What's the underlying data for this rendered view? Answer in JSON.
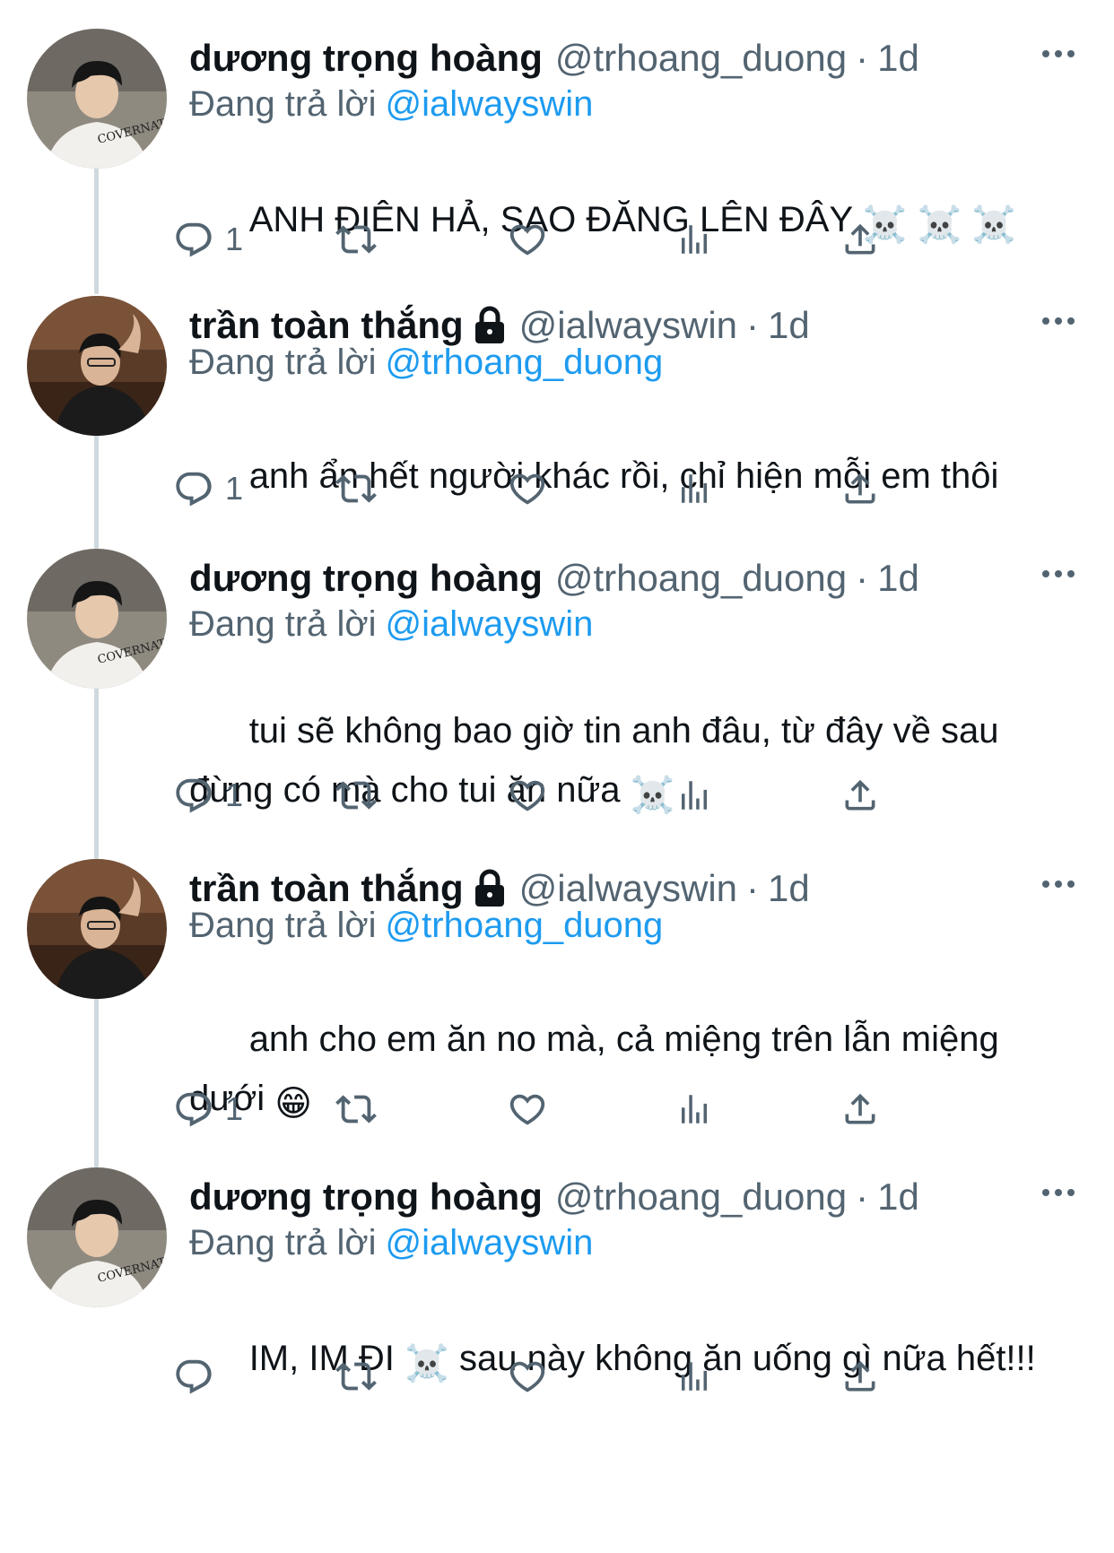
{
  "thread": {
    "tweets": [
      {
        "name": "dương trọng hoàng",
        "handle": "@trhoang_duong",
        "time": "1d",
        "locked": false,
        "reply_prefix": "Đang trả lời",
        "reply_to": "@ialwayswin",
        "text": "ANH ĐIÊN HẢ, SAO ĐĂNG LÊN ĐÂY",
        "text_emoji": "☠️ ☠️ ☠️",
        "reply_count": "1",
        "avatar": "user-hoang"
      },
      {
        "name": "trần toàn thắng",
        "handle": "@ialwayswin",
        "time": "1d",
        "locked": true,
        "reply_prefix": "Đang trả lời",
        "reply_to": "@trhoang_duong",
        "text": "anh ẩn hết người khác rồi, chỉ hiện mỗi em thôi",
        "text_emoji": "",
        "reply_count": "1",
        "avatar": "user-thang"
      },
      {
        "name": "dương trọng hoàng",
        "handle": "@trhoang_duong",
        "time": "1d",
        "locked": false,
        "reply_prefix": "Đang trả lời",
        "reply_to": "@ialwayswin",
        "text": "tui sẽ không bao giờ tin anh đâu, từ đây về sau\nđừng có mà cho tui ăn nữa",
        "text_emoji": "☠️",
        "reply_count": "1",
        "avatar": "user-hoang"
      },
      {
        "name": "trần toàn thắng",
        "handle": "@ialwayswin",
        "time": "1d",
        "locked": true,
        "reply_prefix": "Đang trả lời",
        "reply_to": "@trhoang_duong",
        "text": "anh cho em ăn no mà, cả miệng trên lẫn miệng\ndưới",
        "text_emoji": "😁",
        "reply_count": "1",
        "avatar": "user-thang"
      },
      {
        "name": "dương trọng hoàng",
        "handle": "@trhoang_duong",
        "time": "1d",
        "locked": false,
        "reply_prefix": "Đang trả lời",
        "reply_to": "@ialwayswin",
        "text": "IM, IM ĐI",
        "text_emoji": "☠️",
        "text_after": " sau này không ăn uống gì nữa hết!!!",
        "reply_count": "",
        "avatar": "user-hoang"
      }
    ]
  },
  "separator": "·",
  "icons": [
    "reply-icon",
    "retweet-icon",
    "like-icon",
    "views-icon",
    "share-icon",
    "more-icon",
    "lock-icon"
  ],
  "colors": {
    "text": "#0f1419",
    "muted": "#536471",
    "link": "#1d9bf0",
    "thread_line": "#cfd9de"
  }
}
